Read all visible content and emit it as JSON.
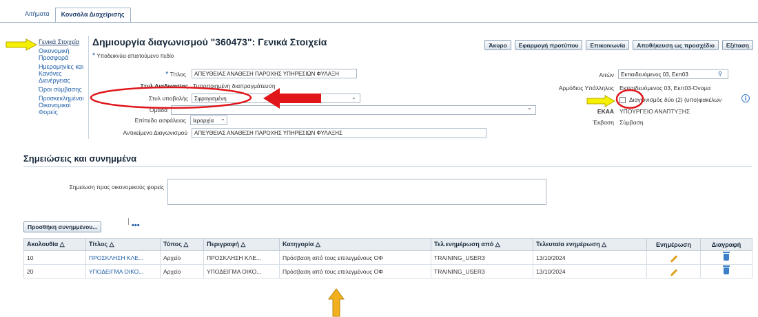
{
  "tabs": [
    "Αιτήματα",
    "Κονσόλα Διαχείρισης"
  ],
  "sidebar": [
    "Γενικά Στοιχεία",
    "Οικονομική Προσφορά",
    "Ημερομηνίες και Κανόνες Διενέργειας",
    "Όροι σύμβασης",
    "Προσκεκλημένοι Οικονομικοί Φορείς"
  ],
  "page_title": "Δημιουργία διαγωνισμού \"360473\": Γενικά Στοιχεία",
  "required_note": "Υποδεικνύει απαιτούμενο πεδίο",
  "buttons": [
    "Άκυρο",
    "Εφαρμογή προτύπου",
    "Επικοινωνία",
    "Αποθήκευση ως προσχέδιο",
    "Εξέταση"
  ],
  "form": {
    "title_label": "Τίτλος",
    "title_value": "ΑΠΕΥΘΕΙΑΣ ΑΝΑΘΕΣΗ ΠΑΡΟΧΗΣ ΥΠΗΡΕΣΙΩΝ ΦΥΛΑΞΗ",
    "proc_style_label": "Στυλ Διαδικασίας",
    "proc_style_value": "Τυποποιημένη διαπραγμάτευση",
    "submission_style_label": "Στυλ υποβολής",
    "submission_style_value": "Σφραγισμένη",
    "group_label": "Ομάδα",
    "security_label": "Επίπεδο ασφάλειας",
    "security_value": "Ιεραρχία",
    "subject_label": "Αντικείμενο Διαγωνισμού",
    "subject_value": "ΑΠΕΥΘΕΙΑΣ ΑΝΑΘΕΣΗ ΠΑΡΟΧΗΣ ΥΠΗΡΕΣΙΩΝ ΦΥΛΑΞΗΣ",
    "requester_label": "Αιτών",
    "requester_value": "Εκπαιδευόμενος 03, Εκπ03",
    "officer_label": "Αρμόδιος Υπάλληλος",
    "officer_value": "Εκπαιδευόμενος 03, Εκπ03-Όνομα",
    "two_envelopes_label": "Διαγωνισμός δύο (2) (υπο)φακέλων",
    "ekaa_label": "ΕΚΑΑ",
    "ekaa_value": "ΥΠΟΥΡΓΕΙΟ ΑΝΑΠΤΥΞΗΣ",
    "version_label": "Έκβαση",
    "version_value": "Σύμβαση"
  },
  "notes_section": {
    "title": "Σημειώσεις και συνημμένα",
    "supplier_note_label": "Σημείωση προς οικονομικούς φορείς",
    "add_attachment": "Προσθήκη συνημμένου...",
    "more": "•••"
  },
  "table": {
    "headers": [
      "Ακολουθία △",
      "Τίτλος △",
      "Τύπος △",
      "Περιγραφή △",
      "Κατηγορία △",
      "Τελ.ενημέρωση από △",
      "Τελευταία ενημέρωση △",
      "Ενημέρωση",
      "Διαγραφή"
    ],
    "rows": [
      [
        "10",
        "ΠΡΟΣΚΛΗΣΗ ΚΛΕ...",
        "Αρχείο",
        "ΠΡΟΣΚΛΗΣΗ ΚΛΕ...",
        "Πρόσβαση από τους επιλεγμένους ΟΦ",
        "TRAINING_USER3",
        "13/10/2024"
      ],
      [
        "20",
        "ΥΠΟΔΕΙΓΜΑ ΟΙΚΟ...",
        "Αρχείο",
        "ΥΠΟΔΕΙΓΜΑ ΟΙΚΟ...",
        "Πρόσβαση από τους επιλεγμένους ΟΦ",
        "TRAINING_USER3",
        "13/10/2024"
      ]
    ]
  },
  "colors": {
    "accent": "#1f5fa8",
    "red_annotation": "#e0161b",
    "yellow_arrow": "#f5f000",
    "orange_arrow": "#f2b01e"
  }
}
